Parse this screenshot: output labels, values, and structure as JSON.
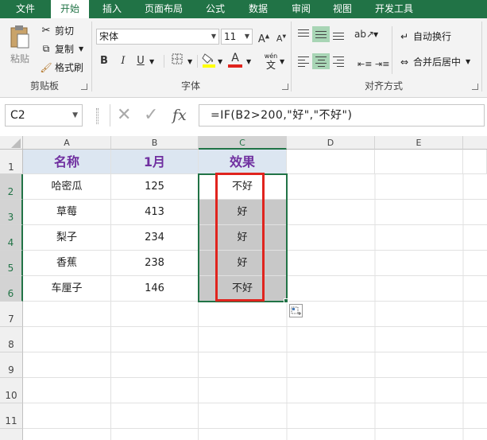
{
  "tabs": [
    {
      "label": "文件",
      "active": false
    },
    {
      "label": "开始",
      "active": true
    },
    {
      "label": "插入",
      "active": false
    },
    {
      "label": "页面布局",
      "active": false
    },
    {
      "label": "公式",
      "active": false
    },
    {
      "label": "数据",
      "active": false
    },
    {
      "label": "审阅",
      "active": false
    },
    {
      "label": "视图",
      "active": false
    },
    {
      "label": "开发工具",
      "active": false
    }
  ],
  "ribbon": {
    "clipboard": {
      "group_label": "剪贴板",
      "paste": "粘贴",
      "cut": "剪切",
      "copy": "复制",
      "format_painter": "格式刷"
    },
    "font": {
      "group_label": "字体",
      "font_name": "宋体",
      "font_size": "11",
      "bold": "B",
      "italic": "I",
      "underline": "U",
      "font_color_letter": "A",
      "phonetic_top": "wén",
      "phonetic_letter": "文"
    },
    "alignment": {
      "group_label": "对齐方式",
      "wrap_text": "自动换行",
      "merge_center": "合并后居中"
    }
  },
  "formula_bar": {
    "name_box": "C2",
    "fx": "fx",
    "formula": "=IF(B2>200,\"好\",\"不好\")"
  },
  "grid": {
    "columns": [
      "A",
      "B",
      "C",
      "D",
      "E"
    ],
    "rows": [
      "1",
      "2",
      "3",
      "4",
      "5",
      "6",
      "7",
      "8",
      "9",
      "10",
      "11"
    ],
    "header": [
      "名称",
      "1月",
      "效果"
    ],
    "data": [
      [
        "哈密瓜",
        "125",
        "不好"
      ],
      [
        "草莓",
        "413",
        "好"
      ],
      [
        "梨子",
        "234",
        "好"
      ],
      [
        "香蕉",
        "238",
        "好"
      ],
      [
        "车厘子",
        "146",
        "不好"
      ]
    ],
    "selected_cell": "C2"
  },
  "colors": {
    "excel_green": "#217346",
    "header_fill": "#dce6f1",
    "header_text": "#7030a0",
    "selection_fill": "#c8c8c8",
    "highlight_box": "#e0241e"
  }
}
